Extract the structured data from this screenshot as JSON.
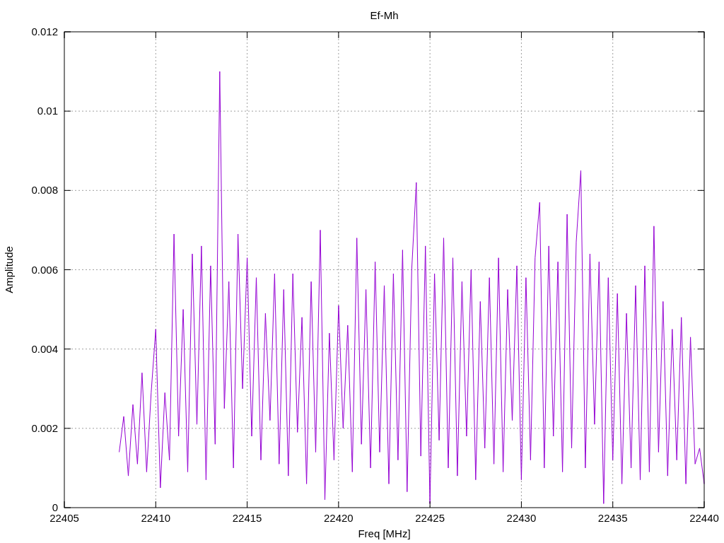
{
  "chart_data": {
    "type": "line",
    "grid": true,
    "title": "Ef-Mh",
    "xlabel": "Freq [MHz]",
    "ylabel": "Amplitude",
    "xlim": [
      22405,
      22440
    ],
    "ylim": [
      0,
      0.012
    ],
    "xticks": [
      22405,
      22410,
      22415,
      22420,
      22425,
      22430,
      22435,
      22440
    ],
    "yticks": [
      {
        "value": 0,
        "label": "0"
      },
      {
        "value": 0.002,
        "label": "0.002"
      },
      {
        "value": 0.004,
        "label": "0.004"
      },
      {
        "value": 0.006,
        "label": "0.006"
      },
      {
        "value": 0.008,
        "label": "0.008"
      },
      {
        "value": 0.01,
        "label": "0.01"
      },
      {
        "value": 0.012,
        "label": "0.012"
      }
    ],
    "x": [
      22408,
      22408.25,
      22408.5,
      22408.75,
      22409,
      22409.25,
      22409.5,
      22409.75,
      22410,
      22410.25,
      22410.5,
      22410.75,
      22411,
      22411.25,
      22411.5,
      22411.75,
      22412,
      22412.25,
      22412.5,
      22412.75,
      22413,
      22413.25,
      22413.5,
      22413.75,
      22414,
      22414.25,
      22414.5,
      22414.75,
      22415,
      22415.25,
      22415.5,
      22415.75,
      22416,
      22416.25,
      22416.5,
      22416.75,
      22417,
      22417.25,
      22417.5,
      22417.75,
      22418,
      22418.25,
      22418.5,
      22418.75,
      22419,
      22419.25,
      22419.5,
      22419.75,
      22420,
      22420.25,
      22420.5,
      22420.75,
      22421,
      22421.25,
      22421.5,
      22421.75,
      22422,
      22422.25,
      22422.5,
      22422.75,
      22423,
      22423.25,
      22423.5,
      22423.75,
      22424,
      22424.25,
      22424.5,
      22424.75,
      22425,
      22425.25,
      22425.5,
      22425.75,
      22426,
      22426.25,
      22426.5,
      22426.75,
      22427,
      22427.25,
      22427.5,
      22427.75,
      22428,
      22428.25,
      22428.5,
      22428.75,
      22429,
      22429.25,
      22429.5,
      22429.75,
      22430,
      22430.25,
      22430.5,
      22430.75,
      22431,
      22431.25,
      22431.5,
      22431.75,
      22432,
      22432.25,
      22432.5,
      22432.75,
      22433,
      22433.25,
      22433.5,
      22433.75,
      22434,
      22434.25,
      22434.5,
      22434.75,
      22435,
      22435.25,
      22435.5,
      22435.75,
      22436,
      22436.25,
      22436.5,
      22436.75,
      22437,
      22437.25,
      22437.5,
      22437.75,
      22438,
      22438.25,
      22438.5,
      22438.75,
      22439,
      22439.25,
      22439.5,
      22439.75,
      22440
    ],
    "series": [
      {
        "color": "#9400d3",
        "values": [
          0.0014,
          0.0023,
          0.0008,
          0.0026,
          0.0011,
          0.0034,
          0.0009,
          0.0029,
          0.0045,
          0.0005,
          0.0029,
          0.0012,
          0.0069,
          0.0018,
          0.005,
          0.0009,
          0.0064,
          0.0021,
          0.0066,
          0.0007,
          0.0061,
          0.0016,
          0.011,
          0.0025,
          0.0057,
          0.001,
          0.0069,
          0.003,
          0.0063,
          0.0018,
          0.0058,
          0.0012,
          0.0049,
          0.0022,
          0.0059,
          0.0011,
          0.0055,
          0.0008,
          0.0059,
          0.0019,
          0.0048,
          0.0006,
          0.0057,
          0.0014,
          0.007,
          0.0002,
          0.0044,
          0.0012,
          0.0051,
          0.002,
          0.0046,
          0.0009,
          0.0068,
          0.0016,
          0.0055,
          0.001,
          0.0062,
          0.0014,
          0.0056,
          0.0006,
          0.0059,
          0.0012,
          0.0065,
          0.0004,
          0.006,
          0.0082,
          0.0013,
          0.0066,
          0.0001,
          0.0059,
          0.0017,
          0.0068,
          0.001,
          0.0063,
          0.0008,
          0.0057,
          0.0018,
          0.006,
          0.0007,
          0.0052,
          0.0015,
          0.0058,
          0.0011,
          0.0063,
          0.0009,
          0.0055,
          0.0022,
          0.0061,
          0.0007,
          0.0058,
          0.0012,
          0.0063,
          0.0077,
          0.001,
          0.0066,
          0.0018,
          0.0062,
          0.0009,
          0.0074,
          0.0015,
          0.0067,
          0.0085,
          0.001,
          0.0064,
          0.0021,
          0.0062,
          0.0001,
          0.0058,
          0.0012,
          0.0054,
          0.0006,
          0.0049,
          0.001,
          0.0056,
          0.0007,
          0.0061,
          0.0009,
          0.0071,
          0.0014,
          0.0052,
          0.0008,
          0.0045,
          0.0012,
          0.0048,
          0.0006,
          0.0043,
          0.0011,
          0.0015,
          0.0006
        ]
      }
    ]
  }
}
